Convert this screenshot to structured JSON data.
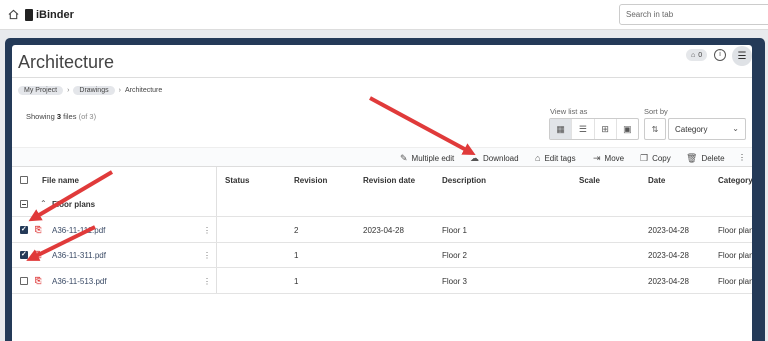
{
  "topbar": {
    "logo": "iBinder",
    "search_placeholder": "Search in tab"
  },
  "header": {
    "title": "Architecture",
    "tag_count": "0",
    "info": "i"
  },
  "breadcrumb": [
    "My Project",
    "Drawings",
    "Architecture"
  ],
  "summary": {
    "prefix": "Showing",
    "count": "3",
    "unit": "files",
    "total": "(of 3)"
  },
  "view": {
    "label": "View list as"
  },
  "sort": {
    "label": "Sort by",
    "value": "Category"
  },
  "actions": {
    "multiple_edit": "Multiple edit",
    "download": "Download",
    "edit_tags": "Edit tags",
    "move": "Move",
    "copy": "Copy",
    "delete": "Delete"
  },
  "table": {
    "columns": {
      "file_name": "File name",
      "status": "Status",
      "revision": "Revision",
      "revision_date": "Revision date",
      "description": "Description",
      "scale": "Scale",
      "date": "Date",
      "category": "Category"
    },
    "group": "Floor plans",
    "rows": [
      {
        "file": "A36-11-111.pdf",
        "status": "",
        "revision": "2",
        "revision_date": "2023-04-28",
        "description": "Floor 1",
        "scale": "",
        "date": "2023-04-28",
        "category": "Floor plans",
        "checked": true
      },
      {
        "file": "A36-11-311.pdf",
        "status": "",
        "revision": "1",
        "revision_date": "",
        "description": "Floor 2",
        "scale": "",
        "date": "2023-04-28",
        "category": "Floor plans",
        "checked": true
      },
      {
        "file": "A36-11-513.pdf",
        "status": "",
        "revision": "1",
        "revision_date": "",
        "description": "Floor 3",
        "scale": "",
        "date": "2023-04-28",
        "category": "Floor plans",
        "checked": false
      }
    ]
  },
  "colors": {
    "frame": "#243a58",
    "arrow": "#e03a3a",
    "pdf": "#dd3333"
  }
}
